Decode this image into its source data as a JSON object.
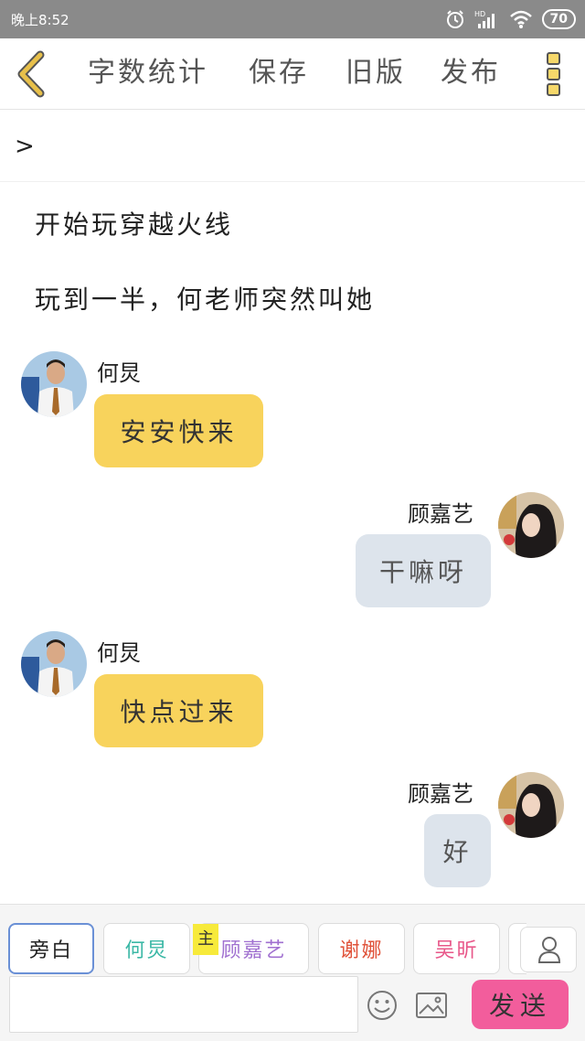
{
  "status_bar": {
    "time": "晚上8:52",
    "battery": "70",
    "network": "HD",
    "icons": [
      "alarm-icon",
      "signal-icon",
      "wifi-icon"
    ]
  },
  "toolbar": {
    "back_icon": "chevron-left-icon",
    "items": [
      {
        "label": "字数统计"
      },
      {
        "label": "保存"
      },
      {
        "label": "旧版"
      },
      {
        "label": "发布"
      }
    ],
    "more_icon": "more-vertical-icon"
  },
  "path": {
    "chevron": ">"
  },
  "narration": [
    {
      "text": "开始玩穿越火线"
    },
    {
      "text": "玩到一半，何老师突然叫她"
    }
  ],
  "messages": [
    {
      "speaker": "何炅",
      "text": "安安快来",
      "side": "left"
    },
    {
      "speaker": "顾嘉艺",
      "text": "干嘛呀",
      "side": "right"
    },
    {
      "speaker": "何炅",
      "text": "快点过来",
      "side": "left"
    },
    {
      "speaker": "顾嘉艺",
      "text": "好",
      "side": "right"
    }
  ],
  "roles": [
    {
      "label": "旁白",
      "color": "#333333",
      "active": true
    },
    {
      "label": "何炅",
      "color": "#3cb8a6"
    },
    {
      "label": "顾嘉艺",
      "color": "#a070d0"
    },
    {
      "label": "谢娜",
      "color": "#e0533a"
    },
    {
      "label": "吴昕",
      "color": "#e8588a"
    }
  ],
  "main_badge": "主",
  "input": {
    "value": "",
    "placeholder": ""
  },
  "send_label": "发送",
  "colors": {
    "accent_yellow": "#f8d35c",
    "bubble_gray": "#dde4ec",
    "send_pink": "#f25d9c",
    "back_arrow": "#e4b83a"
  }
}
